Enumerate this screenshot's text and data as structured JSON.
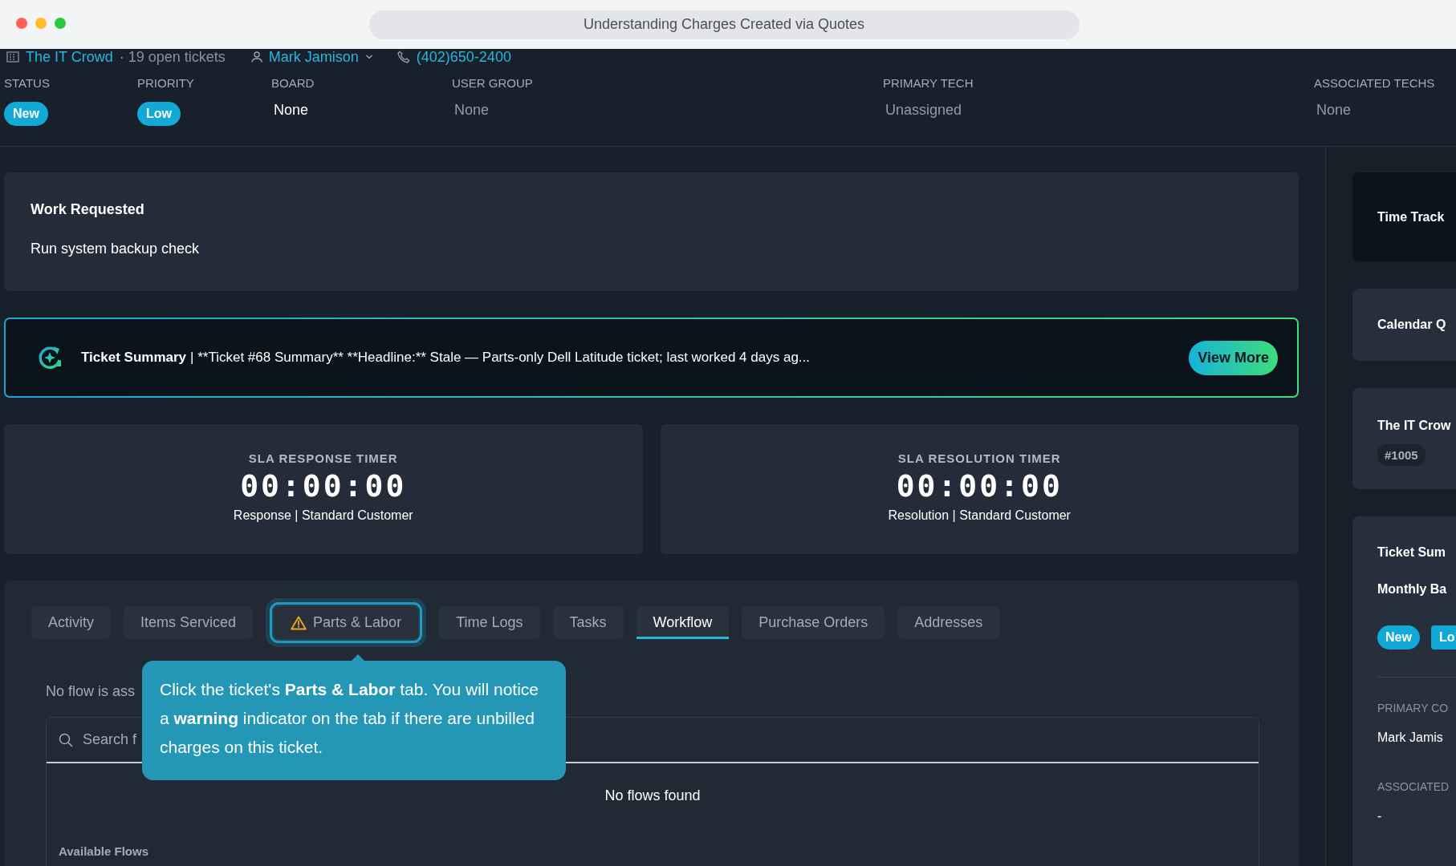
{
  "window": {
    "title": "Understanding Charges Created via Quotes"
  },
  "header": {
    "company": "The IT Crowd",
    "open_tickets": "· 19 open tickets",
    "contact": "Mark Jamison",
    "phone": "(402)650-2400"
  },
  "fields": [
    {
      "label": "STATUS",
      "kind": "badge",
      "value": "New"
    },
    {
      "label": "PRIORITY",
      "kind": "badge",
      "value": "Low"
    },
    {
      "label": "BOARD",
      "kind": "text",
      "value": "None",
      "muted": false
    },
    {
      "label": "USER GROUP",
      "kind": "text",
      "value": "None",
      "muted": true
    },
    {
      "label": "PRIMARY TECH",
      "kind": "text",
      "value": "Unassigned",
      "muted": true
    },
    {
      "label": "ASSOCIATED TECHS",
      "kind": "text",
      "value": "None",
      "muted": true
    }
  ],
  "work_requested": {
    "title": "Work Requested",
    "text": "Run system backup check"
  },
  "ticket_summary": {
    "label": "Ticket Summary",
    "text": "| **Ticket #68 Summary** **Headline:** Stale — Parts-only Dell Latitude ticket; last worked 4 days ag...",
    "button": "View More"
  },
  "sla": [
    {
      "title": "SLA RESPONSE TIMER",
      "time": "00:00:00",
      "subtitle": "Response | Standard Customer"
    },
    {
      "title": "SLA RESOLUTION TIMER",
      "time": "00:00:00",
      "subtitle": "Resolution | Standard Customer"
    }
  ],
  "tabs": [
    {
      "label": "Activity",
      "selected": false,
      "warning": false,
      "highlighted": false
    },
    {
      "label": "Items Serviced",
      "selected": false,
      "warning": false,
      "highlighted": false
    },
    {
      "label": "Parts & Labor",
      "selected": false,
      "warning": true,
      "highlighted": true
    },
    {
      "label": "Time Logs",
      "selected": false,
      "warning": false,
      "highlighted": false
    },
    {
      "label": "Tasks",
      "selected": false,
      "warning": false,
      "highlighted": false
    },
    {
      "label": "Workflow",
      "selected": true,
      "warning": false,
      "highlighted": false
    },
    {
      "label": "Purchase Orders",
      "selected": false,
      "warning": false,
      "highlighted": false
    },
    {
      "label": "Addresses",
      "selected": false,
      "warning": false,
      "highlighted": false
    }
  ],
  "workflow": {
    "notice": "No flow is ass",
    "search": {
      "placeholder": "Search f"
    },
    "empty": "No flows found",
    "section": "Available Flows"
  },
  "tooltip": {
    "text": "Click the ticket's **Parts & Labor** tab. You will notice a **warning** indicator on the tab if there are unbilled charges on this ticket."
  },
  "side_cards": [
    {
      "kind": "title",
      "title": "Time Track",
      "selected": true
    },
    {
      "kind": "title",
      "title": "Calendar Q",
      "selected": false
    },
    {
      "kind": "company",
      "title": "The IT Crow",
      "badge": "#1005",
      "selected": false
    },
    {
      "kind": "summary",
      "title": "Ticket Sum",
      "subtitle": "Monthly Ba",
      "badges": [
        "New",
        "Lo"
      ],
      "fields": [
        {
          "label": "PRIMARY CO",
          "value": "Mark Jamis"
        },
        {
          "label": "ASSOCIATED",
          "value": "-"
        }
      ],
      "selected": false
    }
  ]
}
